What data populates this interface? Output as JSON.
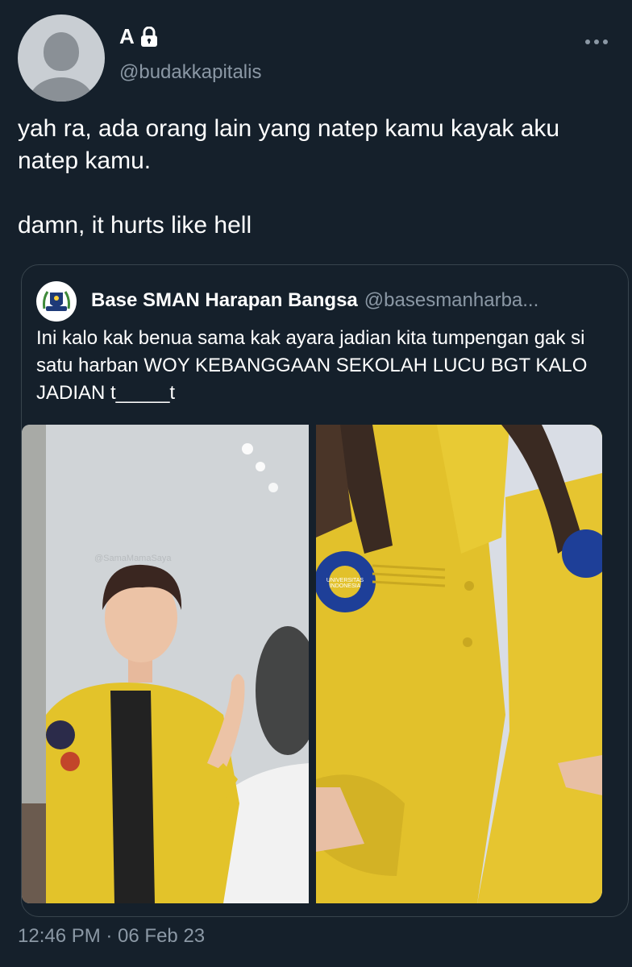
{
  "tweet": {
    "display_name": "A",
    "handle": "@budakkapitalis",
    "text_lines": [
      "yah ra, ada orang lain yang natep kamu kayak aku natep kamu.",
      "damn, it hurts like hell"
    ],
    "timestamp": "12:46 PM · 06 Feb 23"
  },
  "quote": {
    "name": "Base SMAN Harapan Bangsa",
    "handle": "@basesmanharba...",
    "text": "Ini kalo kak benua sama kak ayara jadian kita tumpengan gak si satu harban WOY KEBANGGAAN SEKOLAH LUCU BGT KALO JADIAN t_____t",
    "avatar_logo_text": "SMAN HARAPAN BANGSA",
    "badge_text": "UNIVERSITAS INDONESIA",
    "watermark_text": "@SamaMamaSaya"
  },
  "icons": {
    "lock": "lock-icon",
    "more": "more-horizontal-icon"
  },
  "colors": {
    "background": "#15202b",
    "secondary_text": "#8b98a5",
    "border": "#38444d",
    "jacket_yellow": "#e2c12b"
  }
}
